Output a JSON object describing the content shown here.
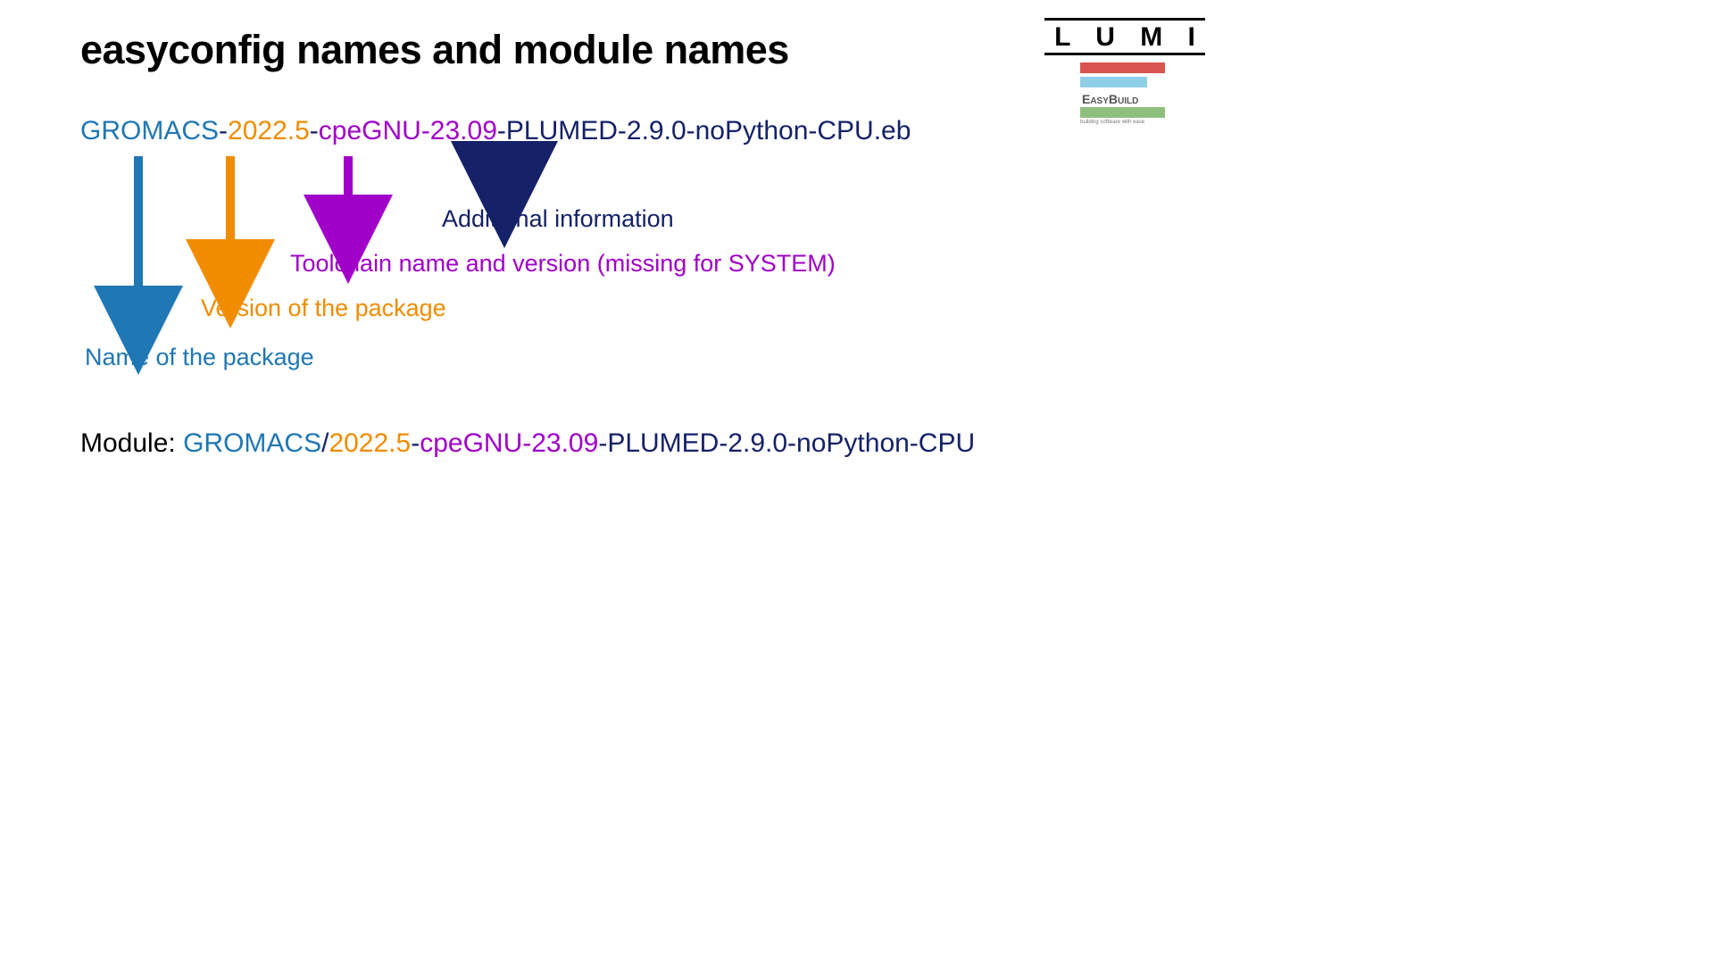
{
  "title": "easyconfig names and module names",
  "logo": {
    "lumi": "L U M I",
    "easybuild": "EasyBuild",
    "eb_tagline": "building software with ease"
  },
  "filename": {
    "name": "GROMACS",
    "version": "2022.5",
    "toolchain": "cpeGNU-23.09",
    "suffix": "PLUMED-2.9.0-noPython-CPU",
    "ext": ".eb"
  },
  "labels": {
    "name": "Name of the package",
    "version": "Version of the package",
    "toolchain": "Toolchain name and version (missing for SYSTEM)",
    "additional": "Additional information"
  },
  "module": {
    "prefix": "Module: ",
    "name": "GROMACS",
    "sep": "/",
    "version": "2022.5",
    "toolchain": "cpeGNU-23.09",
    "suffix": "PLUMED-2.9.0-noPython-CPU"
  },
  "colors": {
    "blue": "#1f77b4",
    "orange": "#f08c00",
    "purple": "#a000c8",
    "navy": "#152168"
  }
}
